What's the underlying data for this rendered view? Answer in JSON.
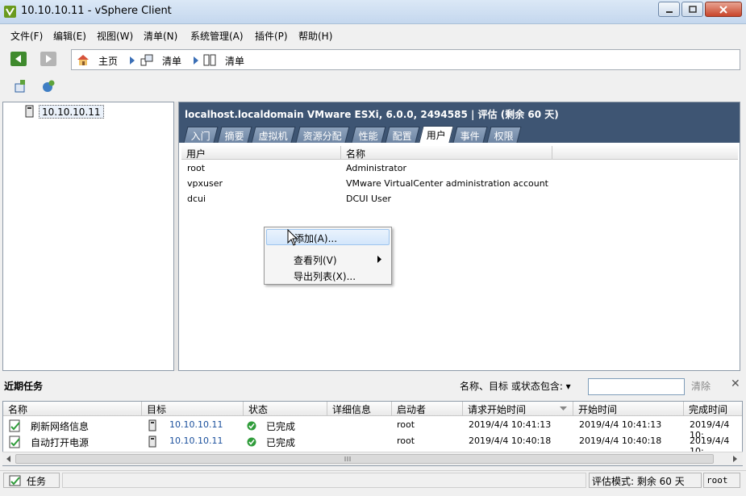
{
  "window": {
    "title": "10.10.10.11 - vSphere Client"
  },
  "menu": [
    "文件(F)",
    "编辑(E)",
    "视图(W)",
    "清单(N)",
    "系统管理(A)",
    "插件(P)",
    "帮助(H)"
  ],
  "breadcrumb": {
    "home": "主页",
    "item1": "清单",
    "item2": "清单"
  },
  "tree": {
    "host": "10.10.10.11"
  },
  "host_panel": {
    "title": "localhost.localdomain VMware ESXi, 6.0.0, 2494585 | 评估 (剩余 60 天)",
    "tabs": [
      "入门",
      "摘要",
      "虚拟机",
      "资源分配",
      "性能",
      "配置",
      "用户",
      "事件",
      "权限"
    ],
    "active_tab": "用户"
  },
  "users_grid": {
    "columns": [
      "用户",
      "名称"
    ],
    "rows": [
      {
        "user": "root",
        "name": "Administrator"
      },
      {
        "user": "vpxuser",
        "name": "VMware VirtualCenter administration account"
      },
      {
        "user": "dcui",
        "name": "DCUI User"
      }
    ]
  },
  "context_menu": {
    "add": "添加(A)...",
    "view_columns": "查看列(V)",
    "export": "导出列表(X)..."
  },
  "recent_tasks": {
    "title": "近期任务",
    "filter_label": "名称、目标 或状态包含: ▾",
    "filter_value": "",
    "clear": "清除",
    "close": "✕",
    "columns": [
      "名称",
      "目标",
      "状态",
      "详细信息",
      "启动者",
      "请求开始时间",
      "开始时间",
      "完成时间"
    ],
    "rows": [
      {
        "name": "刷新网络信息",
        "target": "10.10.10.11",
        "status": "已完成",
        "details": "",
        "initiator": "root",
        "requested": "2019/4/4 10:41:13",
        "start": "2019/4/4 10:41:13",
        "complete": "2019/4/4 10:"
      },
      {
        "name": "自动打开电源",
        "target": "10.10.10.11",
        "status": "已完成",
        "details": "",
        "initiator": "root",
        "requested": "2019/4/4 10:40:18",
        "start": "2019/4/4 10:40:18",
        "complete": "2019/4/4 10:"
      }
    ]
  },
  "statusbar": {
    "tasks": "任务",
    "eval": "评估模式: 剩余 60 天",
    "user": "root"
  },
  "colors": {
    "header_bg": "#3e5573",
    "link": "#1a4f9c",
    "ok": "#2f9c3a"
  }
}
